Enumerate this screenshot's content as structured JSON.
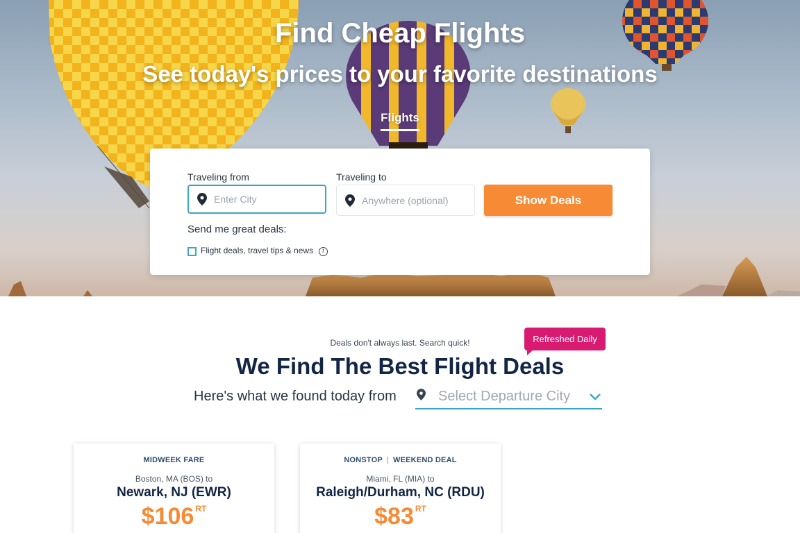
{
  "hero": {
    "title": "Find Cheap Flights",
    "subtitle": "See today's prices to your favorite destinations",
    "tab": "Flights"
  },
  "search": {
    "from_label": "Traveling from",
    "from_placeholder": "Enter City",
    "to_label": "Traveling to",
    "to_placeholder": "Anywhere (optional)",
    "submit_label": "Show Deals",
    "send_label": "Send me great deals:",
    "checkbox_label": "Flight deals, travel tips & news",
    "checkbox_checked": false
  },
  "deals_section": {
    "tagline": "Deals don't always last. Search quick!",
    "badge": "Refreshed Daily",
    "heading": "We Find The Best Flight Deals",
    "found_text": "Here's what we found today from",
    "departure_placeholder": "Select Departure City"
  },
  "deals": [
    {
      "tags": [
        "MIDWEEK FARE"
      ],
      "from": "Boston, MA (BOS) to",
      "to": "Newark, NJ (EWR)",
      "price": "$106",
      "trip": "RT"
    },
    {
      "tags": [
        "NONSTOP",
        "WEEKEND DEAL"
      ],
      "from": "Miami, FL (MIA) to",
      "to": "Raleigh/Durham, NC (RDU)",
      "price": "$83",
      "trip": "RT"
    }
  ],
  "colors": {
    "accent_orange": "#f78a34",
    "badge_pink": "#d81b71",
    "focus_teal": "#3aa6c4",
    "heading_navy": "#132544"
  }
}
